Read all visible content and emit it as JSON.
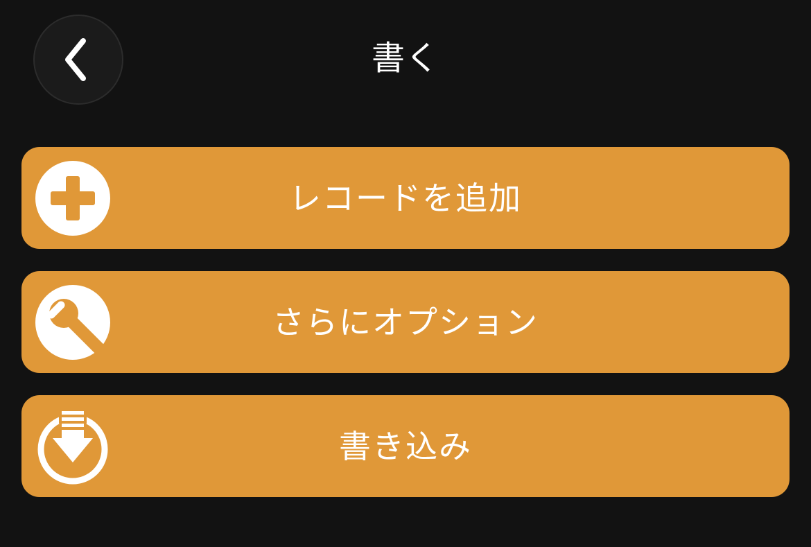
{
  "theme": {
    "background": "#121212",
    "accent": "#e09838",
    "text": "#ffffff"
  },
  "header": {
    "title": "書く",
    "back_icon": "chevron-left-icon"
  },
  "actions": [
    {
      "label": "レコードを追加",
      "icon": "plus-circle-icon"
    },
    {
      "label": "さらにオプション",
      "icon": "wrench-icon"
    },
    {
      "label": "書き込み",
      "icon": "download-arrow-icon"
    }
  ]
}
